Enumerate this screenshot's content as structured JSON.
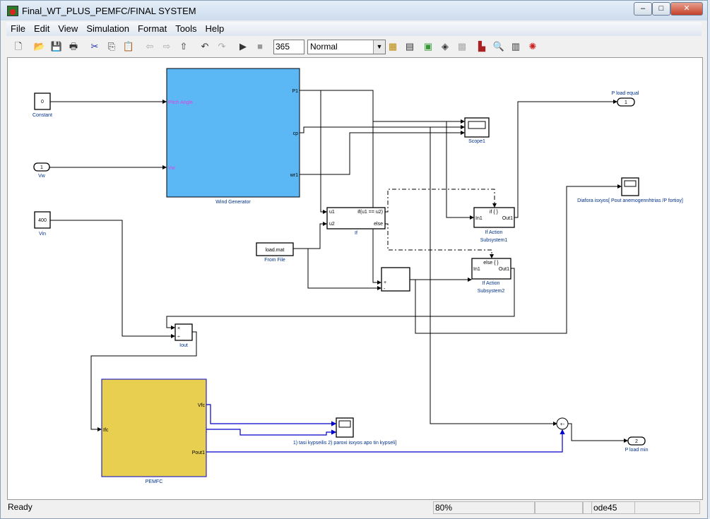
{
  "window": {
    "title": "Final_WT_PLUS_PEMFC/FINAL SYSTEM",
    "controls": [
      "minimize",
      "maximize",
      "close"
    ]
  },
  "menu": [
    "File",
    "Edit",
    "View",
    "Simulation",
    "Format",
    "Tools",
    "Help"
  ],
  "toolbar": {
    "icons": [
      "new-icon",
      "open-icon",
      "save-icon",
      "print-icon",
      "cut-icon",
      "copy-icon",
      "paste-icon",
      "back-icon",
      "forward-icon",
      "up-icon",
      "undo-icon",
      "redo-icon",
      "play-icon",
      "stop-icon"
    ],
    "stop_time": "365",
    "sim_mode": "Normal",
    "right_icons": [
      "build-icon",
      "update-icon",
      "library-icon",
      "explorer-icon",
      "debug-icon",
      "model-advisor-icon",
      "find-icon",
      "configure-icon",
      "viewer-icon"
    ]
  },
  "blocks": {
    "constant": {
      "value": "0",
      "label": "Constant"
    },
    "vw_in": {
      "value": "1",
      "label": "Vw"
    },
    "vin": {
      "value": "400",
      "label": "Vin"
    },
    "wind": {
      "label": "Wind Generator",
      "in1": "Pitch Angle",
      "in2": "Vw",
      "out1": "P1",
      "out2": "cp",
      "out3": "wr1",
      "color": "#5bb8f5"
    },
    "scope1": {
      "label": "Scope1"
    },
    "ifblock": {
      "label": "If",
      "u1": "u1",
      "u2": "u2",
      "cond": "if(u1 == u2)",
      "else": "else"
    },
    "fromfile": {
      "value": "load.mat",
      "label": "From File"
    },
    "sub1": {
      "title": "if { }",
      "in": "In1",
      "out": "Out1",
      "label1": "If Action",
      "label2": "Subsystem1"
    },
    "sub2": {
      "title": "else { }",
      "in": "In1",
      "out": "Out1",
      "label1": "If Action",
      "label2": "Subsystem2"
    },
    "sum_plus": "+",
    "sum_minus": "-",
    "product": {
      "label": "Iout",
      "times": "×",
      "div": "÷"
    },
    "pemfc": {
      "label": "PEMFC",
      "in": "Ifc",
      "out1": "Vfc",
      "out2": "Pout1",
      "color": "#e8cf50"
    },
    "scope2": {
      "label": "1) tasi kypseilis 2) paroxi isxyos apo tin kypseli]"
    },
    "scope3": {
      "label": "Diafora isxyos[ Pout anemogennhtrias /P fortioy]"
    },
    "out1": {
      "value": "1",
      "label": "P load equal"
    },
    "out2": {
      "value": "2",
      "label": "P load min"
    }
  },
  "status": {
    "text": "Ready",
    "zoom": "80%",
    "solver": "ode45"
  }
}
